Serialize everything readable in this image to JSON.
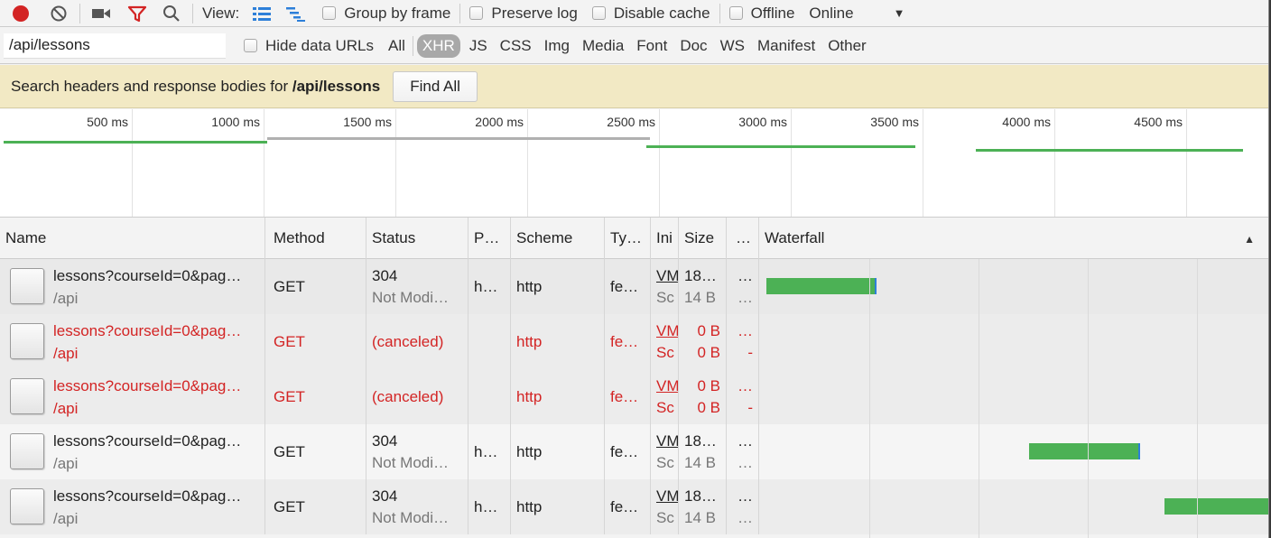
{
  "colors": {
    "record": "#d32424",
    "filter_active": "#d32424",
    "error_text": "#d32424",
    "bar_green": "#4cb155",
    "search_banner": "#f2e9c4"
  },
  "toolbar": {
    "view_label": "View:",
    "group_by_frame": "Group by frame",
    "preserve_log": "Preserve log",
    "disable_cache": "Disable cache",
    "offline": "Offline",
    "throttle": "Online",
    "throttle_arrow": "▼"
  },
  "filter": {
    "value": "/api/lessons",
    "hide_data_urls": "Hide data URLs",
    "types": [
      "All",
      "XHR",
      "JS",
      "CSS",
      "Img",
      "Media",
      "Font",
      "Doc",
      "WS",
      "Manifest",
      "Other"
    ],
    "active_type": "XHR"
  },
  "search": {
    "text": "Search headers and response bodies for ",
    "query": "/api/lessons",
    "find_all": "Find All"
  },
  "overview": {
    "ticks": [
      "500 ms",
      "1000 ms",
      "1500 ms",
      "2000 ms",
      "2500 ms",
      "3000 ms",
      "3500 ms",
      "4000 ms",
      "4500 ms"
    ]
  },
  "table": {
    "columns": [
      "Name",
      "Method",
      "Status",
      "P…",
      "Scheme",
      "Ty…",
      "Ini",
      "Size",
      "…",
      "Waterfall"
    ],
    "sort_arrow": "▲",
    "rows": [
      {
        "name": "lessons?courseId=0&pag…",
        "path": "/api",
        "method": "GET",
        "status": "304",
        "status2": "Not Modi…",
        "protocol": "h…",
        "scheme": "http",
        "type": "fe…",
        "init": "VM",
        "init2": "Sc",
        "size": "18…",
        "size2": "14 B",
        "time": "…",
        "time2": "…",
        "error": false
      },
      {
        "name": "lessons?courseId=0&pag…",
        "path": "/api",
        "method": "GET",
        "status": "(canceled)",
        "status2": "",
        "protocol": "",
        "scheme": "http",
        "type": "fe…",
        "init": "VM",
        "init2": "Sc",
        "size": "0 B",
        "size2": "0 B",
        "time": "…",
        "time2": "-",
        "error": true
      },
      {
        "name": "lessons?courseId=0&pag…",
        "path": "/api",
        "method": "GET",
        "status": "(canceled)",
        "status2": "",
        "protocol": "",
        "scheme": "http",
        "type": "fe…",
        "init": "VM",
        "init2": "Sc",
        "size": "0 B",
        "size2": "0 B",
        "time": "…",
        "time2": "-",
        "error": true
      },
      {
        "name": "lessons?courseId=0&pag…",
        "path": "/api",
        "method": "GET",
        "status": "304",
        "status2": "Not Modi…",
        "protocol": "h…",
        "scheme": "http",
        "type": "fe…",
        "init": "VM",
        "init2": "Sc",
        "size": "18…",
        "size2": "14 B",
        "time": "…",
        "time2": "…",
        "error": false
      },
      {
        "name": "lessons?courseId=0&pag…",
        "path": "/api",
        "method": "GET",
        "status": "304",
        "status2": "Not Modi…",
        "protocol": "h…",
        "scheme": "http",
        "type": "fe…",
        "init": "VM",
        "init2": "Sc",
        "size": "18…",
        "size2": "14 B",
        "time": "…",
        "time2": "…",
        "error": false
      }
    ]
  }
}
